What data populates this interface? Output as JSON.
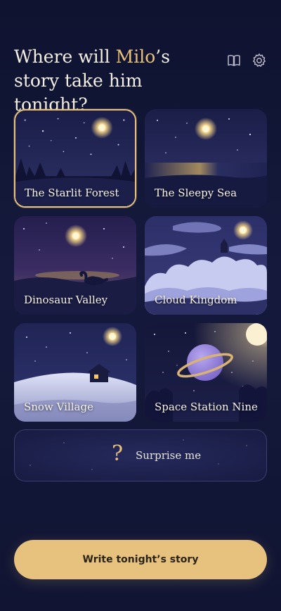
{
  "header": {
    "title_before": "Where will ",
    "child_name": "Milo",
    "title_after": "’s story take him tonight?",
    "icons": [
      "book-icon",
      "gear-icon"
    ]
  },
  "worlds": [
    {
      "label": "The Starlit Forest",
      "selected": true
    },
    {
      "label": "The Sleepy Sea",
      "selected": false
    },
    {
      "label": "Dinosaur Valley",
      "selected": false
    },
    {
      "label": "Cloud Kingdom",
      "selected": false
    },
    {
      "label": "Snow Village",
      "selected": false
    },
    {
      "label": "Space Station Nine",
      "selected": false
    }
  ],
  "surprise": {
    "icon": "?",
    "label": "Surprise me"
  },
  "cta": {
    "label": "Write tonight’s story"
  },
  "colors": {
    "accent": "#e7c27c",
    "background": "#13173a",
    "button": "#e6c27e"
  }
}
